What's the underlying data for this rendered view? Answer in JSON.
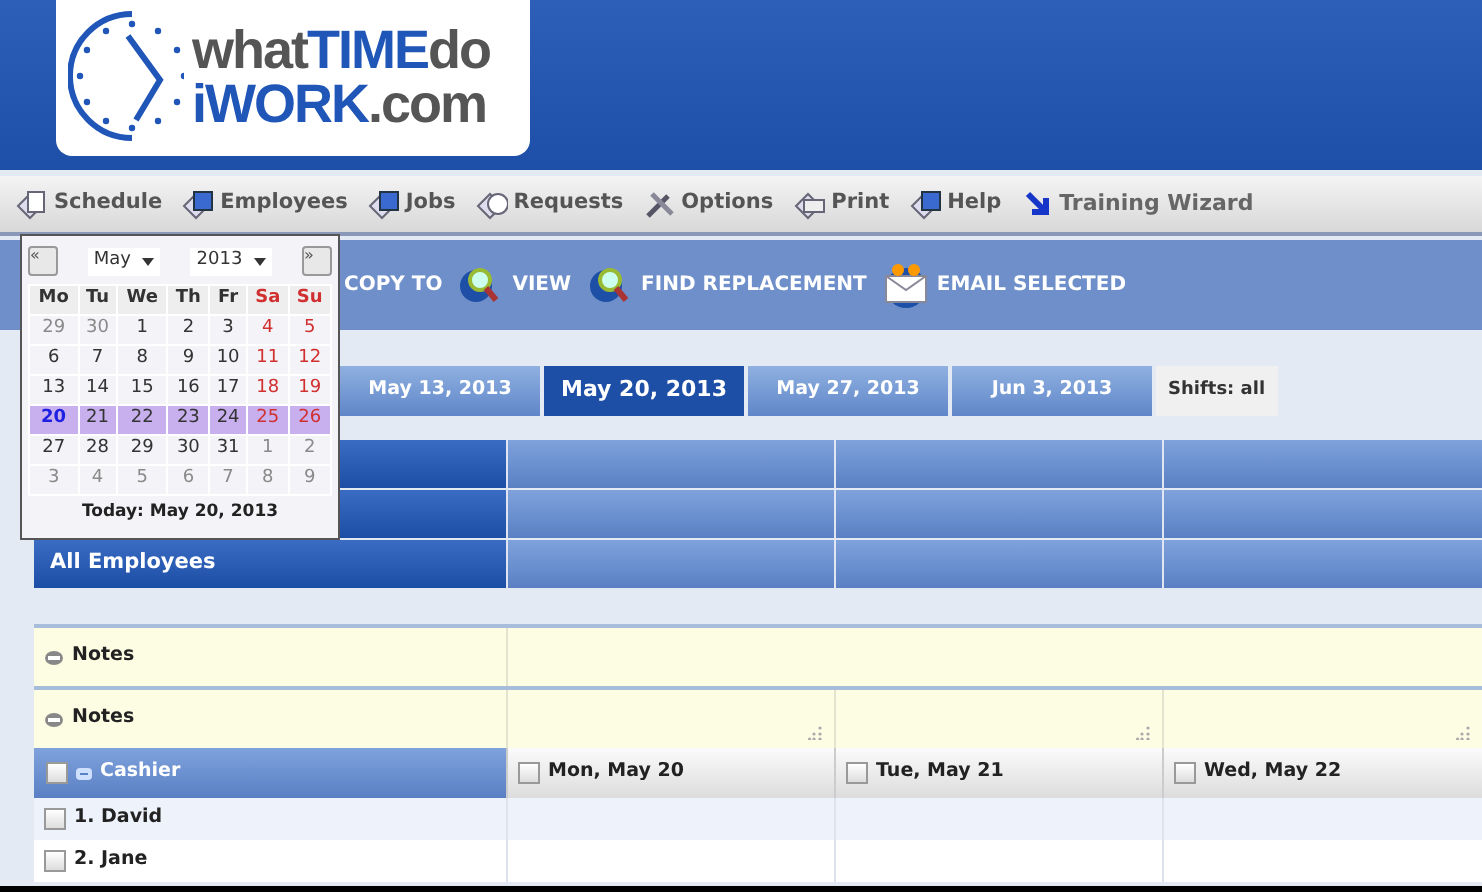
{
  "logo": {
    "lines": [
      [
        {
          "text": "what",
          "kind": "plain"
        },
        {
          "text": "TIME",
          "kind": "accent"
        },
        {
          "text": "do",
          "kind": "plain"
        }
      ],
      [
        {
          "text": "iWORK",
          "kind": "accent"
        },
        {
          "text": ".com",
          "kind": "plain"
        }
      ]
    ]
  },
  "menu": [
    {
      "label": "Schedule"
    },
    {
      "label": "Employees"
    },
    {
      "label": "Jobs"
    },
    {
      "label": "Requests"
    },
    {
      "label": "Options"
    },
    {
      "label": "Print"
    },
    {
      "label": "Help"
    },
    {
      "label": "Training Wizard"
    }
  ],
  "toolbar": [
    {
      "label": "COPY TO"
    },
    {
      "label": "VIEW"
    },
    {
      "label": "FIND REPLACEMENT"
    },
    {
      "label": "EMAIL SELECTED"
    }
  ],
  "week_tabs": [
    {
      "label": "May 13, 2013",
      "selected": false
    },
    {
      "label": "May 20, 2013",
      "selected": true
    },
    {
      "label": "May 27, 2013",
      "selected": false
    },
    {
      "label": "Jun 3, 2013",
      "selected": false
    }
  ],
  "shifts_filter": "Shifts: all",
  "all_employees": "All Employees",
  "notes": [
    "Notes",
    "Notes"
  ],
  "schedule": {
    "group": {
      "label": "Cashier",
      "checked": false
    },
    "days": [
      {
        "label": "Mon, May 20",
        "checked": false
      },
      {
        "label": "Tue, May 21",
        "checked": false
      },
      {
        "label": "Wed, May 22",
        "checked": false
      }
    ],
    "employees": [
      {
        "label": "1. David",
        "checked": false
      },
      {
        "label": "2. Jane",
        "checked": false
      }
    ]
  },
  "calendar": {
    "prev": "«",
    "next": "»",
    "month": "May",
    "year": "2013",
    "weekdays": [
      {
        "label": "Mo",
        "kind": "weekday"
      },
      {
        "label": "Tu",
        "kind": "weekday"
      },
      {
        "label": "We",
        "kind": "weekday"
      },
      {
        "label": "Th",
        "kind": "weekday"
      },
      {
        "label": "Fr",
        "kind": "weekday"
      },
      {
        "label": "Sa",
        "kind": "weekend"
      },
      {
        "label": "Su",
        "kind": "weekend"
      }
    ],
    "weeks": [
      {
        "selected": false,
        "days": [
          {
            "label": "29",
            "kind": "other"
          },
          {
            "label": "30",
            "kind": "other"
          },
          {
            "label": "1",
            "kind": "weekday"
          },
          {
            "label": "2",
            "kind": "weekday"
          },
          {
            "label": "3",
            "kind": "weekday"
          },
          {
            "label": "4",
            "kind": "weekend"
          },
          {
            "label": "5",
            "kind": "weekend"
          }
        ]
      },
      {
        "selected": false,
        "days": [
          {
            "label": "6",
            "kind": "weekday"
          },
          {
            "label": "7",
            "kind": "weekday"
          },
          {
            "label": "8",
            "kind": "weekday"
          },
          {
            "label": "9",
            "kind": "weekday"
          },
          {
            "label": "10",
            "kind": "weekday"
          },
          {
            "label": "11",
            "kind": "weekend"
          },
          {
            "label": "12",
            "kind": "weekend"
          }
        ]
      },
      {
        "selected": false,
        "days": [
          {
            "label": "13",
            "kind": "weekday"
          },
          {
            "label": "14",
            "kind": "weekday"
          },
          {
            "label": "15",
            "kind": "weekday"
          },
          {
            "label": "16",
            "kind": "weekday"
          },
          {
            "label": "17",
            "kind": "weekday"
          },
          {
            "label": "18",
            "kind": "weekend"
          },
          {
            "label": "19",
            "kind": "weekend"
          }
        ]
      },
      {
        "selected": true,
        "days": [
          {
            "label": "20",
            "kind": "today"
          },
          {
            "label": "21",
            "kind": "weekday"
          },
          {
            "label": "22",
            "kind": "weekday"
          },
          {
            "label": "23",
            "kind": "weekday"
          },
          {
            "label": "24",
            "kind": "weekday"
          },
          {
            "label": "25",
            "kind": "weekend"
          },
          {
            "label": "26",
            "kind": "weekend"
          }
        ]
      },
      {
        "selected": false,
        "days": [
          {
            "label": "27",
            "kind": "weekday"
          },
          {
            "label": "28",
            "kind": "weekday"
          },
          {
            "label": "29",
            "kind": "weekday"
          },
          {
            "label": "30",
            "kind": "weekday"
          },
          {
            "label": "31",
            "kind": "weekday"
          },
          {
            "label": "1",
            "kind": "other"
          },
          {
            "label": "2",
            "kind": "other"
          }
        ]
      },
      {
        "selected": false,
        "days": [
          {
            "label": "3",
            "kind": "other"
          },
          {
            "label": "4",
            "kind": "other"
          },
          {
            "label": "5",
            "kind": "other"
          },
          {
            "label": "6",
            "kind": "other"
          },
          {
            "label": "7",
            "kind": "other"
          },
          {
            "label": "8",
            "kind": "other"
          },
          {
            "label": "9",
            "kind": "other"
          }
        ]
      }
    ],
    "today": "Today: May 20, 2013"
  }
}
